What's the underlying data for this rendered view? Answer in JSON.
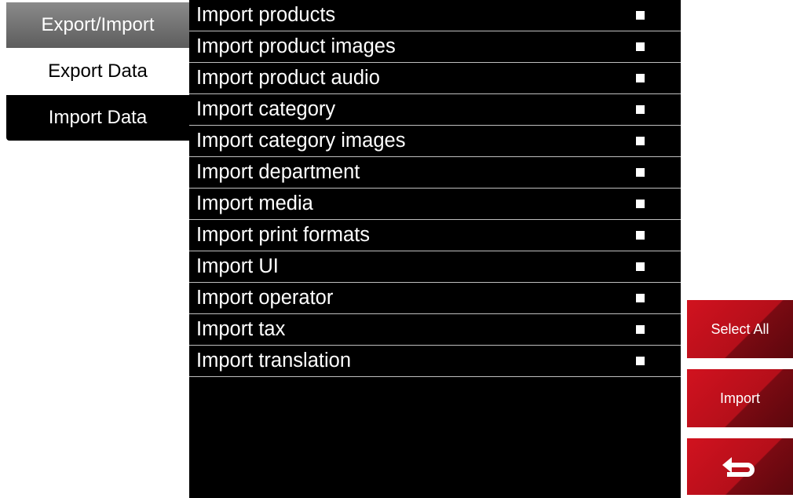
{
  "sidebar": {
    "header": "Export/Import",
    "items": [
      {
        "label": "Export Data"
      },
      {
        "label": "Import Data"
      }
    ]
  },
  "import_list": [
    {
      "label": "Import products",
      "checked": true
    },
    {
      "label": "Import product images",
      "checked": true
    },
    {
      "label": "Import product audio",
      "checked": true
    },
    {
      "label": "Import category",
      "checked": true
    },
    {
      "label": "Import category images",
      "checked": true
    },
    {
      "label": "Import department",
      "checked": true
    },
    {
      "label": "Import media",
      "checked": true
    },
    {
      "label": "Import print formats",
      "checked": true
    },
    {
      "label": "Import UI",
      "checked": true
    },
    {
      "label": "Import operator",
      "checked": true
    },
    {
      "label": "Import tax",
      "checked": true
    },
    {
      "label": "Import translation",
      "checked": true
    }
  ],
  "actions": {
    "select_all": "Select All",
    "import": "Import",
    "back_icon": "back-arrow-icon"
  },
  "colors": {
    "accent": "#c8101d",
    "panel": "#000000",
    "header_gray": "#6f6f6f"
  }
}
